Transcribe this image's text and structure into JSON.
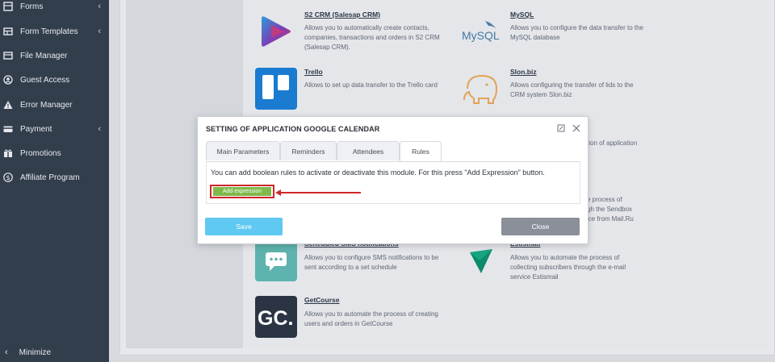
{
  "sidebar": {
    "items": [
      {
        "label": "Forms",
        "icon": "forms-icon",
        "has_submenu": true
      },
      {
        "label": "Form Templates",
        "icon": "templates-icon",
        "has_submenu": true
      },
      {
        "label": "File Manager",
        "icon": "folder-icon",
        "has_submenu": false
      },
      {
        "label": "Guest Access",
        "icon": "user-circle-icon",
        "has_submenu": false
      },
      {
        "label": "Error Manager",
        "icon": "warning-icon",
        "has_submenu": false
      },
      {
        "label": "Payment",
        "icon": "card-icon",
        "has_submenu": true
      },
      {
        "label": "Promotions",
        "icon": "gift-icon",
        "has_submenu": false
      },
      {
        "label": "Affiliate Program",
        "icon": "dollar-circle-icon",
        "has_submenu": false
      }
    ],
    "minimize_label": "Minimize"
  },
  "apps": [
    {
      "title": "S2 CRM (Salesap CRM)",
      "desc": "Allows you to automatically create contacts, companies, transactions and orders in S2 CRM (Salesap CRM)."
    },
    {
      "title": "MySQL",
      "desc": "Allows you to configure the data transfer to the MySQL database",
      "logo_text": "MySQL"
    },
    {
      "title": "Trello",
      "desc": "Allows to set up data transfer to the Trello card"
    },
    {
      "title": "Slon.biz",
      "desc": "Allows configuring the transfer of lids to the CRM system Slon.biz"
    },
    {
      "partial_desc_1": "tion of application"
    },
    {
      "partial_desc_2": "e process of",
      "partial_desc_3": "gh the Sendbox",
      "partial_desc_4": "ice from Mail.Ru"
    },
    {
      "title": "Scheduled SMS notifications",
      "desc": "Allows you to configure SMS notifications to be sent according to a set schedule"
    },
    {
      "title": "Estismail",
      "desc": "Allows you to automate the process of collecting subscribers through the e-mail service Estismail"
    },
    {
      "title": "GetCourse",
      "desc": "Allows you to automate the process of creating users and orders in GetCourse",
      "logo_text": "GC."
    }
  ],
  "dialog": {
    "title": "SETTING OF APPLICATION GOOGLE CALENDAR",
    "tabs": [
      "Main Parameters",
      "Reminders",
      "Attendees",
      "Rules"
    ],
    "active_tab": "Rules",
    "rules_text": "You can add boolean rules to activate or deactivate this module. For this press \"Add Expression\" button.",
    "add_button_label": "Add expression",
    "save_label": "Save",
    "close_label": "Close"
  },
  "colors": {
    "sidebar_bg": "#333e4d",
    "save": "#5fc9f2",
    "close": "#8a8f99",
    "add": "#7eb94a",
    "highlight": "#d0262a"
  }
}
